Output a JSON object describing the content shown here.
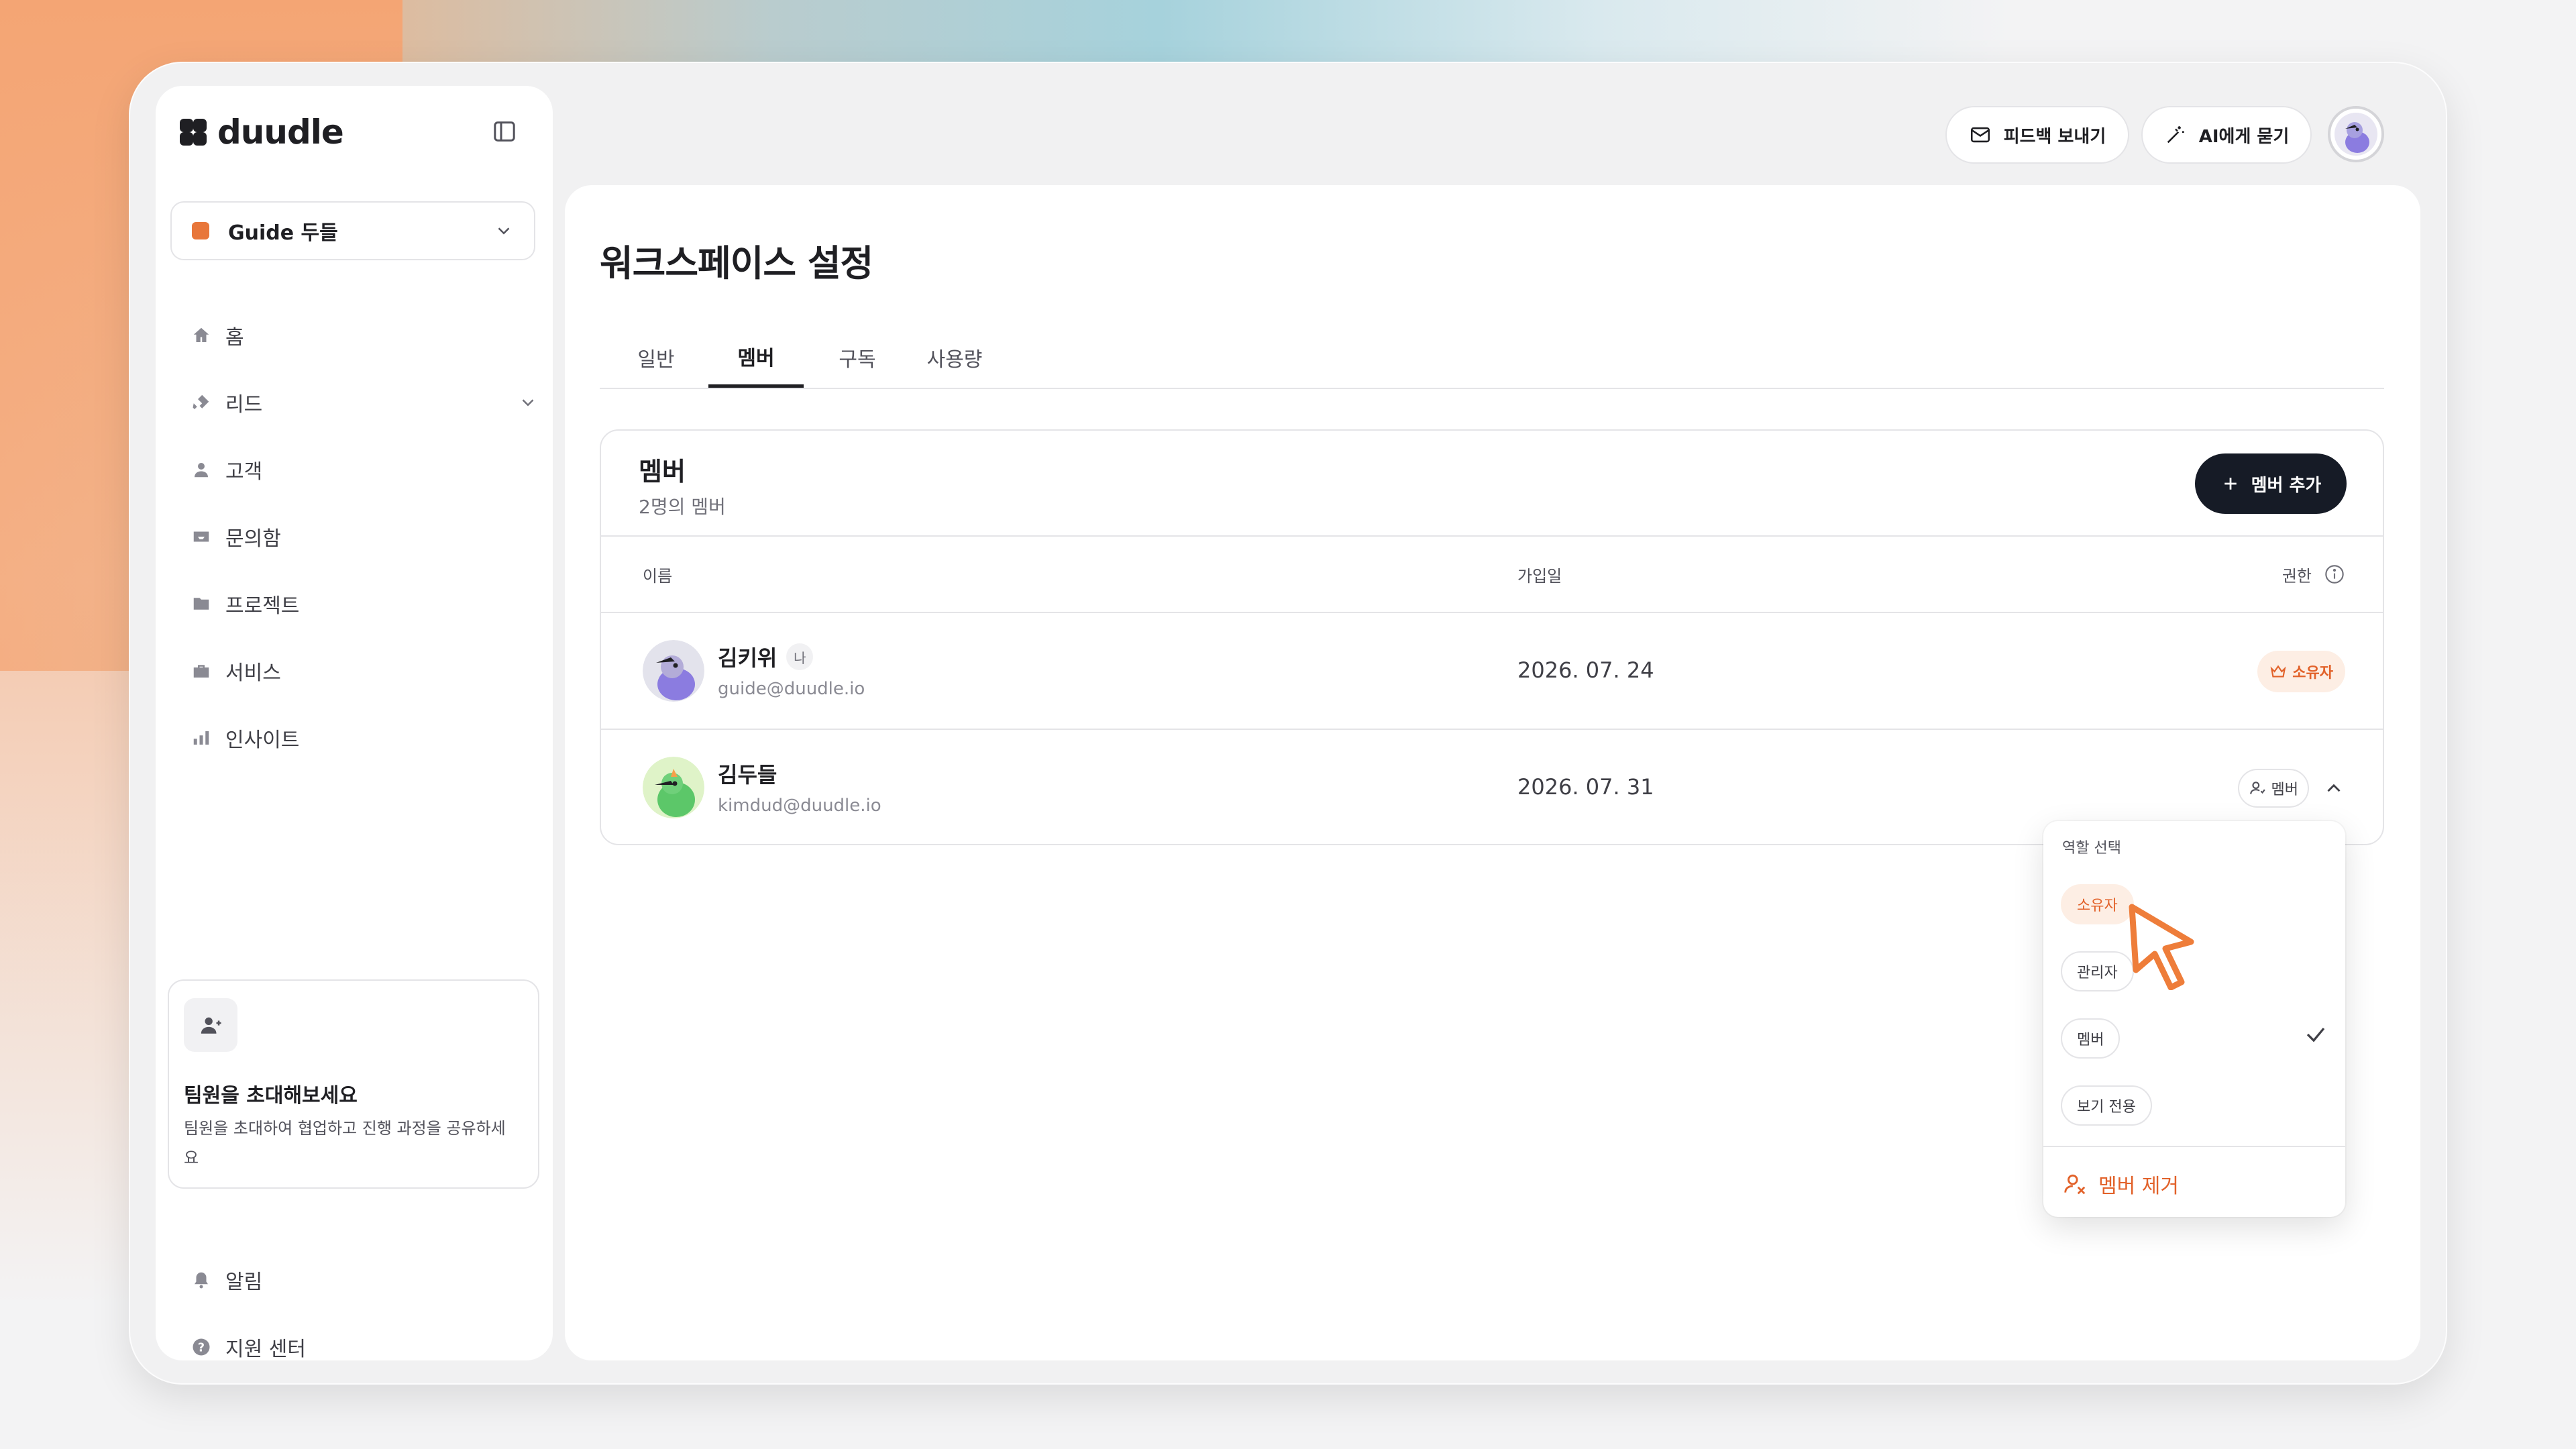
{
  "brand": {
    "logo_text": "duudle"
  },
  "workspace": {
    "name": "Guide 두들"
  },
  "sidebar": {
    "items": [
      {
        "label": "홈",
        "icon": "home-icon"
      },
      {
        "label": "리드",
        "icon": "lead-icon"
      },
      {
        "label": "고객",
        "icon": "user-icon"
      },
      {
        "label": "문의함",
        "icon": "inbox-icon"
      },
      {
        "label": "프로젝트",
        "icon": "folder-icon"
      },
      {
        "label": "서비스",
        "icon": "briefcase-icon"
      },
      {
        "label": "인사이트",
        "icon": "chart-icon"
      }
    ],
    "invite": {
      "title": "팀원을 초대해보세요",
      "desc": "팀원을 초대하여 협업하고 진행 과정을 공유하세요"
    },
    "bottom_items": [
      {
        "label": "알림",
        "icon": "bell-icon"
      },
      {
        "label": "지원 센터",
        "icon": "help-icon"
      }
    ]
  },
  "header": {
    "feedback_label": "피드백 보내기",
    "ask_ai_label": "AI에게 묻기"
  },
  "page": {
    "title": "워크스페이스 설정",
    "tabs": [
      {
        "label": "일반",
        "active": false
      },
      {
        "label": "멤버",
        "active": true
      },
      {
        "label": "구독",
        "active": false
      },
      {
        "label": "사용량",
        "active": false
      }
    ]
  },
  "members": {
    "title": "멤버",
    "subtitle": "2명의 멤버",
    "add_label": "멤버 추가",
    "columns": {
      "name": "이름",
      "joined": "가입일",
      "role": "권한"
    },
    "rows": [
      {
        "name": "김키위",
        "me_badge": "나",
        "email": "guide@duudle.io",
        "joined": "2026. 07. 24",
        "role": "소유자"
      },
      {
        "name": "김두들",
        "email": "kimdud@duudle.io",
        "joined": "2026. 07. 31",
        "role": "멤버"
      }
    ]
  },
  "role_menu": {
    "label": "역할 선택",
    "options": [
      {
        "label": "소유자",
        "highlighted": true,
        "selected": false
      },
      {
        "label": "관리자",
        "highlighted": false,
        "selected": false
      },
      {
        "label": "멤버",
        "highlighted": false,
        "selected": true
      },
      {
        "label": "보기 전용",
        "highlighted": false,
        "selected": false
      }
    ],
    "remove_label": "멤버 제거"
  },
  "colors": {
    "accent": "#e2622a",
    "accent_bg": "#fdeee4",
    "primary_button": "#161b26"
  }
}
